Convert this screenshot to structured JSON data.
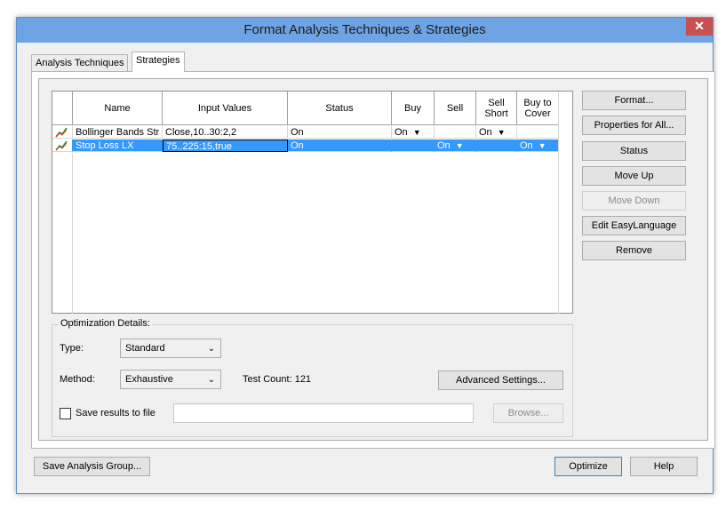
{
  "window": {
    "title": "Format Analysis Techniques & Strategies",
    "close_glyph": "✕"
  },
  "tabs": [
    {
      "label": "Analysis Techniques"
    },
    {
      "label": "Strategies"
    }
  ],
  "grid": {
    "columns": {
      "name": "Name",
      "inputs": "Input Values",
      "status": "Status",
      "buy": "Buy",
      "sell": "Sell",
      "sell_short": "Sell Short",
      "buy_to_cover": "Buy to Cover"
    },
    "rows": [
      {
        "name": "Bollinger Bands Str",
        "inputs": "Close,10..30:2,2",
        "status": "On",
        "buy": "On",
        "sell": "",
        "sell_short": "On",
        "buy_to_cover": "",
        "icon": "strategy-icon"
      },
      {
        "name": "Stop Loss LX",
        "inputs": "75..225:15,true",
        "status": "On",
        "buy": "",
        "sell": "On",
        "sell_short": "",
        "buy_to_cover": "On",
        "icon": "strategy-icon",
        "selected": true
      }
    ]
  },
  "side_buttons": {
    "format": "Format...",
    "properties_all": "Properties for All...",
    "status": "Status",
    "move_up": "Move Up",
    "move_down": "Move Down",
    "edit_easylanguage": "Edit EasyLanguage",
    "remove": "Remove"
  },
  "optimization": {
    "title": "Optimization Details:",
    "type_label": "Type:",
    "type_value": "Standard",
    "method_label": "Method:",
    "method_value": "Exhaustive",
    "test_count": "Test Count: 121",
    "advanced": "Advanced Settings...",
    "save_results": "Save results to file",
    "file_path": "",
    "browse": "Browse..."
  },
  "footer": {
    "save_group": "Save Analysis Group...",
    "optimize": "Optimize",
    "help": "Help"
  },
  "colors": {
    "titlebar": "#6ea3e4",
    "selection": "#3399ff",
    "close": "#c75050"
  }
}
